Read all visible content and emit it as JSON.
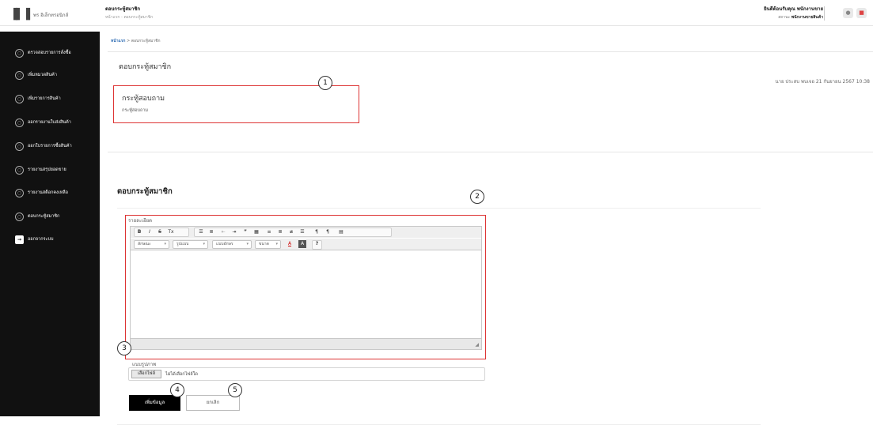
{
  "app": {
    "logo_glyph": "▐▌▐",
    "name": "พร อิเล็กทรอนิกส์"
  },
  "header": {
    "title": "ตอบกระทู้สมาชิก",
    "subtitle": "หน้าแรก - ตอบกระทู้สมาชิก",
    "welcome": "ยินดีต้อนรับคุณ พนักงานขาย",
    "role_prefix": "สถานะ",
    "role": "พนักงานขายสินค้า",
    "user_icon": "user-icon",
    "lock_icon": "lock-icon"
  },
  "sidebar": {
    "items": [
      {
        "label": "ตรวจสอบรายการสั่งซื้อ"
      },
      {
        "label": "เพิ่มหมวดสินค้า"
      },
      {
        "label": "เพิ่มรายการสินค้า"
      },
      {
        "label": "ออกรายงานใบส่งสินค้า"
      },
      {
        "label": "ออกใบรายการซื้อสินค้า"
      },
      {
        "label": "รายงานสรุปยอดขาย"
      },
      {
        "label": "รายงานสต็อกคงเหลือ"
      },
      {
        "label": "ตอบกระทู้สมาชิก"
      },
      {
        "label": "ออกจากระบบ"
      }
    ]
  },
  "breadcrumb": {
    "home": "หน้าแรก",
    "sep": " > ",
    "current": "ตอบกระทู้สมาชิก"
  },
  "question_card": {
    "title": "ตอบกระทู้สมาชิก",
    "posted": "นาย ประสบ พบเจอ 21 กันยายน 2567 10:38",
    "topic": "กระทู้สอบถาม",
    "detail": "กระทู้สอบถาม"
  },
  "form": {
    "title": "ตอบกระทู้สมาชิก",
    "detail_label": "รายละเอียด",
    "toolbar_row1": [
      "B",
      "I",
      "S",
      "Tx",
      "☰",
      "≣",
      "⇤",
      "⇥",
      "”",
      "▦",
      "≡",
      "≣",
      "≢",
      "☰",
      "¶",
      "¶",
      "▤"
    ],
    "toolbar_row2": {
      "style": "ลักษณะ",
      "format": "รูปแบบ",
      "font": "แบบอักษร",
      "size": "ขนาด",
      "text_color": "A",
      "bg_color": "A",
      "help": "?"
    },
    "image_label": "แนบรูปภาพ",
    "file_button": "เลือกไฟล์",
    "file_status": "ไม่ได้เลือกไฟล์ใด",
    "submit": "เพิ่มข้อมูล",
    "cancel": "ยกเลิก"
  },
  "callouts": [
    "1",
    "2",
    "3",
    "4",
    "5"
  ],
  "colors": {
    "highlight": "#dd3333",
    "sidebar_bg": "#111111",
    "primary_button": "#000000",
    "link": "#2f6db4"
  }
}
